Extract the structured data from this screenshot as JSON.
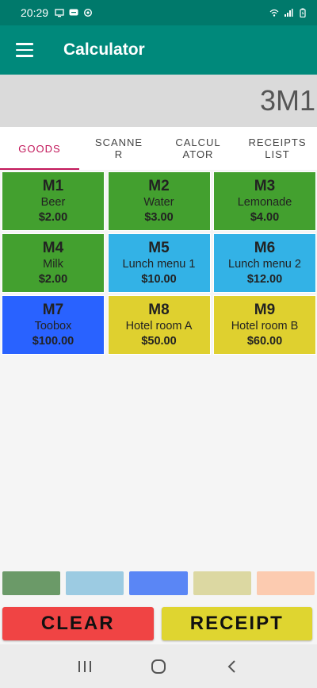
{
  "status_bar": {
    "time": "20:29",
    "left_icons": [
      "monitor-icon",
      "chat-icon",
      "sync-icon"
    ],
    "right_icons": [
      "wifi-icon",
      "signal-icon",
      "battery-icon"
    ]
  },
  "app_bar": {
    "title": "Calculator",
    "menu_icon": "hamburger-menu-icon",
    "background": "#00897b"
  },
  "display": {
    "value": "3M1"
  },
  "tabs": [
    {
      "label": "GOODS",
      "active": true
    },
    {
      "label": "SCANNER",
      "active": false
    },
    {
      "label": "CALCULATOR",
      "active": false
    },
    {
      "label": "RECEIPTS LIST",
      "active": false
    }
  ],
  "goods": [
    {
      "code": "M1",
      "name": "Beer",
      "price": "$2.00",
      "color": "#43a02f"
    },
    {
      "code": "M2",
      "name": "Water",
      "price": "$3.00",
      "color": "#43a02f"
    },
    {
      "code": "M3",
      "name": "Lemonade",
      "price": "$4.00",
      "color": "#43a02f"
    },
    {
      "code": "M4",
      "name": "Milk",
      "price": "$2.00",
      "color": "#43a02f"
    },
    {
      "code": "M5",
      "name": "Lunch menu 1",
      "price": "$10.00",
      "color": "#33b2e6"
    },
    {
      "code": "M6",
      "name": "Lunch menu 2",
      "price": "$12.00",
      "color": "#33b2e6"
    },
    {
      "code": "M7",
      "name": "Toobox",
      "price": "$100.00",
      "color": "#2962ff"
    },
    {
      "code": "M8",
      "name": "Hotel room A",
      "price": "$50.00",
      "color": "#dfd02f"
    },
    {
      "code": "M9",
      "name": "Hotel room B",
      "price": "$60.00",
      "color": "#dfd02f"
    }
  ],
  "color_swatches": [
    "#6b9a68",
    "#9ccbe2",
    "#5a86f5",
    "#dcd8a2",
    "#fccbb0"
  ],
  "actions": {
    "clear_label": "CLEAR",
    "clear_color": "#f04444",
    "receipt_label": "RECEIPT",
    "receipt_color": "#dfd530"
  },
  "nav_bar": {
    "icons": [
      "recent-apps-icon",
      "home-icon",
      "back-icon"
    ]
  }
}
